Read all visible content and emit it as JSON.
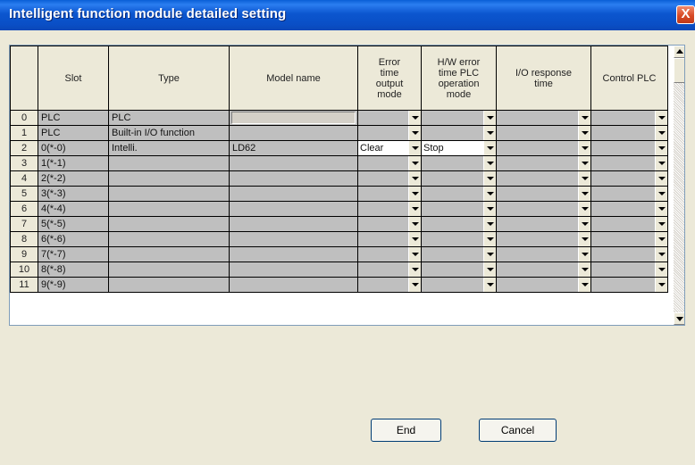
{
  "window": {
    "title": "Intelligent function module detailed setting",
    "close_label": "X"
  },
  "columns": [
    "",
    "Slot",
    "Type",
    "Model name",
    "Error time output mode",
    "H/W error time PLC operation mode",
    "I/O response time",
    "Control PLC"
  ],
  "rows": [
    {
      "num": "0",
      "slot": "PLC",
      "type": "PLC",
      "model": "",
      "error_mode": "",
      "hw_mode": ""
    },
    {
      "num": "1",
      "slot": "PLC",
      "type": "Built-in I/O function",
      "model": "",
      "error_mode": "",
      "hw_mode": ""
    },
    {
      "num": "2",
      "slot": "0(*-0)",
      "type": "Intelli.",
      "model": "LD62",
      "error_mode": "Clear",
      "hw_mode": "Stop"
    },
    {
      "num": "3",
      "slot": "1(*-1)",
      "type": "",
      "model": "",
      "error_mode": "",
      "hw_mode": ""
    },
    {
      "num": "4",
      "slot": "2(*-2)",
      "type": "",
      "model": "",
      "error_mode": "",
      "hw_mode": ""
    },
    {
      "num": "5",
      "slot": "3(*-3)",
      "type": "",
      "model": "",
      "error_mode": "",
      "hw_mode": ""
    },
    {
      "num": "6",
      "slot": "4(*-4)",
      "type": "",
      "model": "",
      "error_mode": "",
      "hw_mode": ""
    },
    {
      "num": "7",
      "slot": "5(*-5)",
      "type": "",
      "model": "",
      "error_mode": "",
      "hw_mode": ""
    },
    {
      "num": "8",
      "slot": "6(*-6)",
      "type": "",
      "model": "",
      "error_mode": "",
      "hw_mode": ""
    },
    {
      "num": "9",
      "slot": "7(*-7)",
      "type": "",
      "model": "",
      "error_mode": "",
      "hw_mode": ""
    },
    {
      "num": "10",
      "slot": "8(*-8)",
      "type": "",
      "model": "",
      "error_mode": "",
      "hw_mode": ""
    },
    {
      "num": "11",
      "slot": "9(*-9)",
      "type": "",
      "model": "",
      "error_mode": "",
      "hw_mode": ""
    }
  ],
  "buttons": {
    "end": "End",
    "cancel": "Cancel"
  }
}
